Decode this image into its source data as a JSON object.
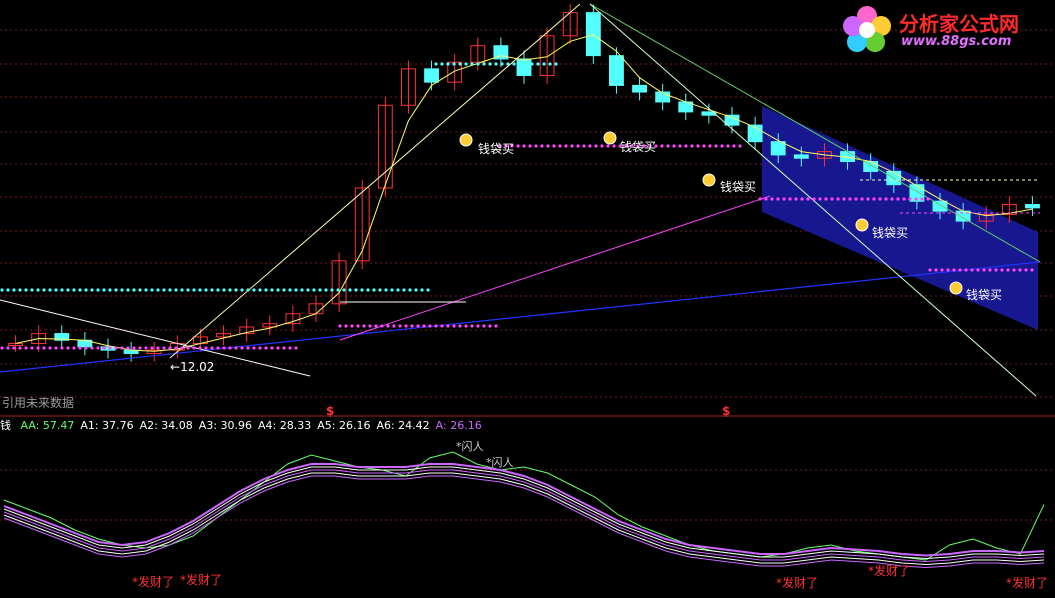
{
  "logo": {
    "title": "分析家公式网",
    "url_text": "www.88gs.com"
  },
  "main_panel": {
    "low_label": "12.02",
    "buy_labels": [
      "钱袋买",
      "钱袋买",
      "钱袋买",
      "钱袋买",
      "钱袋买"
    ],
    "future_note": "引用未来数据",
    "marker_char": "$"
  },
  "indicator_panel": {
    "name": "钱",
    "values": [
      {
        "label": "AA:",
        "value": "57.47",
        "color": "#66ff66"
      },
      {
        "label": "A1:",
        "value": "37.76",
        "color": "#ffffff"
      },
      {
        "label": "A2:",
        "value": "34.08",
        "color": "#ffffff"
      },
      {
        "label": "A3:",
        "value": "30.96",
        "color": "#ffffff"
      },
      {
        "label": "A4:",
        "value": "28.33",
        "color": "#ffffff"
      },
      {
        "label": "A5:",
        "value": "26.16",
        "color": "#ffffff"
      },
      {
        "label": "A6:",
        "value": "24.42",
        "color": "#ffffff"
      },
      {
        "label": "A:",
        "value": "26.16",
        "color": "#cc66ff"
      }
    ],
    "signals": {
      "top1": "闪人",
      "top2": "闪人",
      "bottom": "发财了"
    }
  },
  "chart_data": {
    "type": "candlestick",
    "price_series": [
      12.3,
      12.6,
      12.4,
      12.2,
      12.1,
      12.0,
      12.1,
      12.3,
      12.5,
      12.6,
      12.8,
      12.9,
      13.2,
      13.5,
      14.8,
      17.0,
      19.5,
      20.6,
      20.2,
      20.8,
      21.3,
      20.9,
      20.4,
      21.6,
      22.3,
      21.0,
      20.1,
      19.9,
      19.6,
      19.3,
      19.2,
      18.9,
      18.4,
      18.0,
      17.9,
      18.1,
      17.8,
      17.5,
      17.1,
      16.6,
      16.3,
      16.0,
      16.2,
      16.5,
      16.4
    ],
    "oscillator_AA": [
      60,
      54,
      48,
      40,
      34,
      30,
      28,
      30,
      36,
      48,
      60,
      72,
      84,
      90,
      86,
      82,
      80,
      76,
      88,
      92,
      84,
      80,
      82,
      78,
      70,
      62,
      50,
      42,
      36,
      30,
      26,
      24,
      22,
      24,
      28,
      30,
      26,
      24,
      22,
      20,
      30,
      34,
      28,
      24,
      57
    ],
    "oscillator_A": [
      56,
      50,
      44,
      38,
      32,
      30,
      32,
      38,
      46,
      56,
      66,
      74,
      80,
      84,
      84,
      82,
      82,
      82,
      84,
      84,
      82,
      80,
      76,
      70,
      62,
      54,
      46,
      40,
      34,
      30,
      28,
      26,
      24,
      24,
      26,
      28,
      27,
      26,
      24,
      23,
      24,
      26,
      26,
      25,
      26
    ]
  },
  "colors": {
    "up": "#ff3333",
    "down": "#54ffff",
    "ma": "#ffff66",
    "cyan_dots": "#54ffff",
    "magenta_dots": "#ff44ff",
    "blue_band": "#1a1aa0"
  }
}
